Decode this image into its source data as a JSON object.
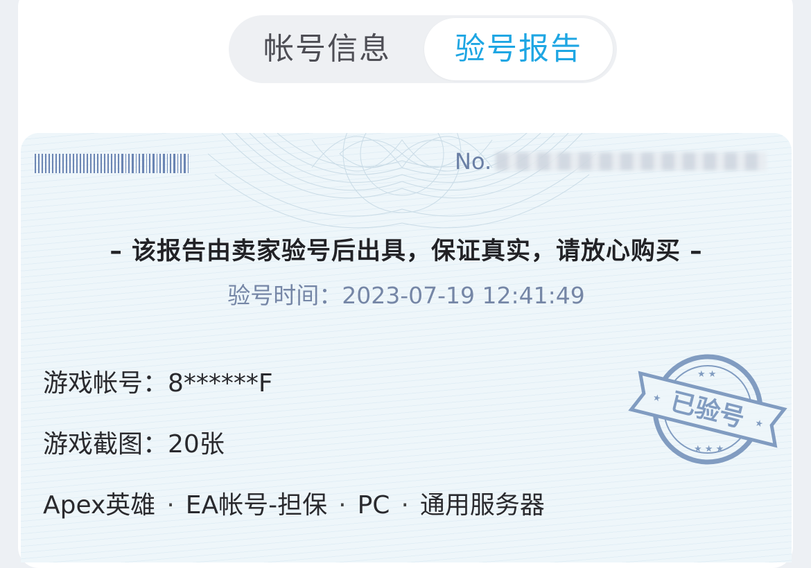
{
  "tabs": {
    "account_info": "帐号信息",
    "check_report": "验号报告",
    "active": "check_report"
  },
  "report": {
    "no_label": "No.",
    "no_value_redacted": true,
    "guarantee_text": "– 该报告由卖家验号后出具，保证真实，请放心购买 –",
    "check_time_label": "验号时间：",
    "check_time_value": "2023-07-19 12:41:49",
    "game_account_label": "游戏帐号：",
    "game_account_value": "8******F",
    "screenshots_label": "游戏截图：",
    "screenshots_value": "20张",
    "tags": [
      "Apex英雄",
      "EA帐号-担保",
      "PC",
      "通用服务器"
    ],
    "tag_separator": "·",
    "stamp_text": "已验号"
  },
  "colors": {
    "accent": "#1ea6e3",
    "tab_inactive": "#4e4e55",
    "report_bg": "#eef6fa",
    "barcode": "#6b85b3",
    "stamp": "#5d7fae",
    "muted_text": "#7586a6"
  },
  "icons": {
    "barcode": "barcode-graphic",
    "stamp": "verified-stamp",
    "watermark": "guilloche-watermark"
  }
}
